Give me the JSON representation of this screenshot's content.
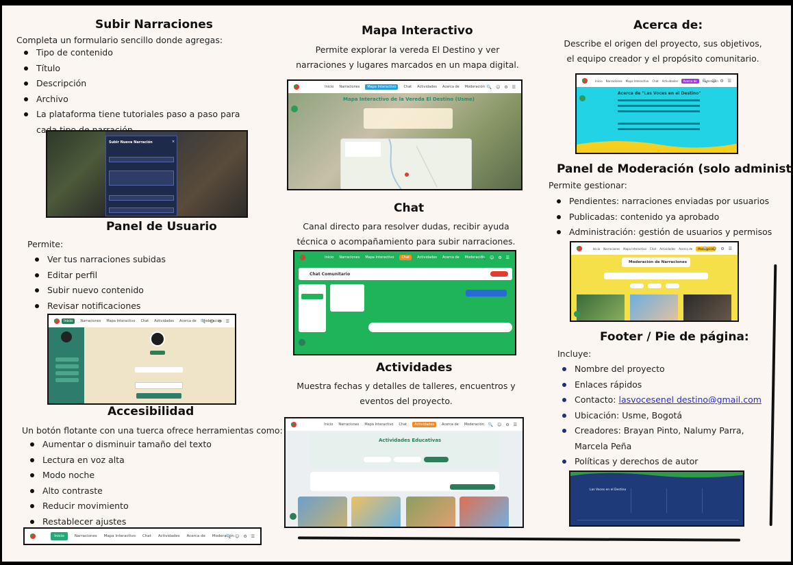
{
  "upload": {
    "title": "Subir Narraciones",
    "intro": "Completa un formulario sencillo donde agregas:",
    "items": [
      "Tipo de contenido",
      "Título",
      "Descripción",
      "Archivo",
      "La plataforma tiene tutoriales paso a paso para cada tipo de narración."
    ],
    "modal_title": "Subir Nueva Narración"
  },
  "user_panel": {
    "title": "Panel de Usuario",
    "intro": "Permite:",
    "items": [
      "Ver tus narraciones subidas",
      "Editar perfil",
      "Subir nuevo contenido",
      "Revisar notificaciones"
    ]
  },
  "accessibility": {
    "title": "Accesibilidad",
    "intro": "Un botón flotante con una tuerca ofrece herramientas como:",
    "items": [
      "Aumentar o disminuir tamaño del texto",
      "Lectura en voz alta",
      "Modo noche",
      "Alto contraste",
      "Reducir movimiento",
      "Restablecer ajustes"
    ]
  },
  "map": {
    "title": "Mapa Interactivo",
    "desc": "Permite explorar la vereda El Destino y ver narraciones y lugares marcados en un mapa digital.",
    "shot_heading": "Mapa Interactivo de la Vereda El Destino (Usme)"
  },
  "chat": {
    "title": "Chat",
    "desc": "Canal directo para resolver dudas, recibir ayuda técnica o acompañamiento para subir narraciones.",
    "shot_heading": "Chat Comunitario"
  },
  "activities": {
    "title": "Actividades",
    "desc": "Muestra fechas y detalles de talleres, encuentros y eventos del proyecto.",
    "shot_heading": "Actividades Educativas"
  },
  "about": {
    "title": "Acerca de:",
    "desc": "Describe el origen del proyecto, sus objetivos, el equipo creador y el propósito comunitario.",
    "shot_heading": "Acerca de \"Las Voces en el Destino\""
  },
  "moderation": {
    "title": "Panel de Moderación (solo administradores)",
    "intro": "Permite gestionar:",
    "items": [
      "Pendientes: narraciones enviadas por usuarios",
      "Publicadas: contenido ya aprobado",
      "Administración: gestión de usuarios y permisos"
    ],
    "shot_heading": "Moderación de Narraciones"
  },
  "footer": {
    "title": "Footer / Pie de página:",
    "intro": "Incluye:",
    "items": [
      "Nombre del proyecto",
      "Enlaces rápidos"
    ],
    "contact_label": "Contacto: ",
    "contact_email": "lasvocesenel destino@gmail.com",
    "items2": [
      "Ubicación: Usme, Bogotá",
      "Creadores: Brayan Pinto, Nalumy Parra, Marcela Peña",
      "Políticas y derechos de autor"
    ],
    "shot_brand": "Las Voces en el Destino"
  },
  "nav": {
    "items": [
      "Inicio",
      "Narraciones",
      "Mapa Interactivo",
      "Chat",
      "Actividades",
      "Acerca de",
      "Moderación"
    ],
    "tools": "🔍 ☺ ⚙ ☰"
  },
  "colors": {
    "background": "#fcf6f2",
    "green": "#2e7d5a",
    "chat_green": "#1fb35a",
    "about_cyan": "#22d3e6",
    "moderation_yellow": "#f5e04a",
    "footer_navy": "#1e3a78"
  }
}
